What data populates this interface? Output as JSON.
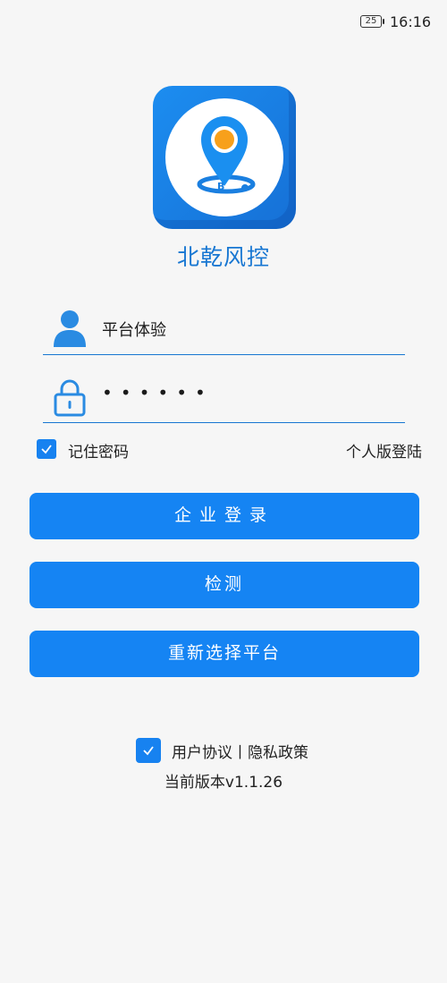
{
  "status_bar": {
    "battery": "25",
    "time": "16:16"
  },
  "app": {
    "name": "北乾风控"
  },
  "login": {
    "username": "平台体验",
    "password_masked": "••••••",
    "remember_label": "记住密码",
    "remember_checked": true,
    "personal_login": "个人版登陆"
  },
  "buttons": {
    "enterprise_login": "企业登录",
    "detect": "检测",
    "reselect_platform": "重新选择平台"
  },
  "footer": {
    "agreement_checked": true,
    "agreement_text": "用户协议丨隐私政策",
    "version": "当前版本v1.1.26"
  },
  "colors": {
    "accent": "#1584f3",
    "title": "#1877d2",
    "icon_blue": "#1a8ff0",
    "orange": "#f7a01b"
  }
}
